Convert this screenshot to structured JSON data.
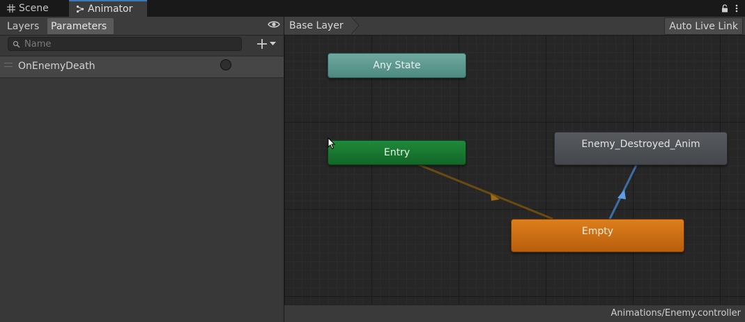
{
  "tabs": [
    {
      "label": "Scene",
      "icon": "grid-icon"
    },
    {
      "label": "Animator",
      "icon": "animator-icon"
    }
  ],
  "left_panel": {
    "tabs": [
      "Layers",
      "Parameters"
    ],
    "search": {
      "placeholder": "Name",
      "value": ""
    },
    "parameters": [
      {
        "name": "OnEnemyDeath",
        "type": "trigger"
      }
    ]
  },
  "graph": {
    "breadcrumb": "Base Layer",
    "live_link_label": "Auto Live Link",
    "states": {
      "any": "Any State",
      "entry": "Entry",
      "destroyed": "Enemy_Destroyed_Anim",
      "empty": "Empty"
    },
    "colors": {
      "any": "#5e9a90",
      "entry": "#18772f",
      "destroyed": "#4e5155",
      "empty": "#cf6f12",
      "transition_default": "#6b4a10",
      "transition_selected": "#4f86c6"
    },
    "status_path": "Animations/Enemy.controller"
  }
}
